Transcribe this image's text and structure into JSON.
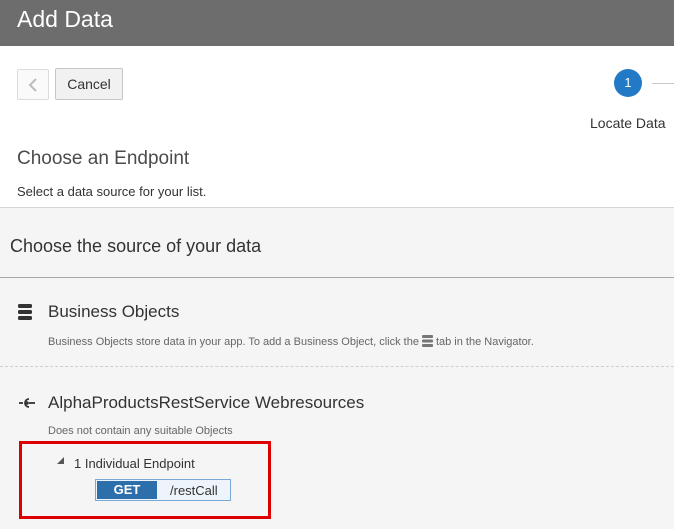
{
  "header": {
    "title": "Add Data"
  },
  "toolbar": {
    "cancel_label": "Cancel"
  },
  "train": {
    "step_number": "1",
    "step_label": "Locate Data"
  },
  "panel": {
    "title": "Choose an Endpoint",
    "description": "Select a data source for your list."
  },
  "source": {
    "heading": "Choose the source of your data"
  },
  "business_objects": {
    "title": "Business Objects",
    "description_before": "Business Objects store data in your app. To add a Business Object, click the",
    "description_after": "tab in the Navigator."
  },
  "service": {
    "title": "AlphaProductsRestService Webresources",
    "description": "Does not contain any suitable Objects",
    "tree_label": "1 Individual Endpoint",
    "endpoint": {
      "method": "GET",
      "path": "/restCall"
    }
  },
  "colors": {
    "header_bg": "#6d6d6d",
    "step_active": "#227ac6",
    "method_badge": "#2d6fab",
    "highlight": "#dd0000"
  },
  "icons": {
    "back": "chevron-left-icon",
    "business_objects": "database-icon",
    "service": "service-connection-icon",
    "tree_toggle": "triangle-expanded-icon"
  }
}
